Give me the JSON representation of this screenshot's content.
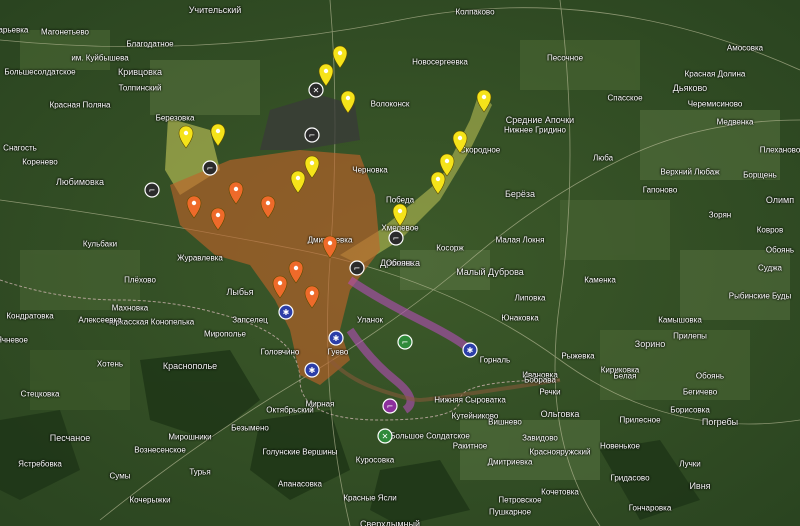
{
  "map": {
    "labels": [
      {
        "text": "Учительский"
      },
      {
        "text": "Колпаково"
      },
      {
        "text": "Марьевка"
      },
      {
        "text": "Амосовка"
      },
      {
        "text": "Магонетьево"
      },
      {
        "text": "Благодатное"
      },
      {
        "text": "им. Куйбышева"
      },
      {
        "text": "Кривцовка"
      },
      {
        "text": "Большесолдатское"
      },
      {
        "text": "Новосергеевка"
      },
      {
        "text": "Песочное"
      },
      {
        "text": "Волоконск"
      },
      {
        "text": "Спасское"
      },
      {
        "text": "Красная Долина"
      },
      {
        "text": "Дьяково"
      },
      {
        "text": "Черемисиново"
      },
      {
        "text": "Толпинский"
      },
      {
        "text": "Красная Поляна"
      },
      {
        "text": "Березовка"
      },
      {
        "text": "Нижнее Гридино"
      },
      {
        "text": "Медвенка"
      },
      {
        "text": "Средние Апочки"
      },
      {
        "text": "Снагость"
      },
      {
        "text": "Скородное"
      },
      {
        "text": "Люба"
      },
      {
        "text": "Верхний Любаж"
      },
      {
        "text": "Плеханово"
      },
      {
        "text": "Гапоново"
      },
      {
        "text": "Берёза"
      },
      {
        "text": "Победа"
      },
      {
        "text": "Малая Локня"
      },
      {
        "text": "Косорж"
      },
      {
        "text": "Борщень"
      },
      {
        "text": "Коренево"
      },
      {
        "text": "Липовка"
      },
      {
        "text": "Любимовка"
      },
      {
        "text": "Кульбаки"
      },
      {
        "text": "Обоянь"
      },
      {
        "text": "Суджа"
      },
      {
        "text": "Журавлевка"
      },
      {
        "text": "Плёхово"
      },
      {
        "text": "Махновка"
      },
      {
        "text": "Малый Дуброва"
      },
      {
        "text": "Дмитриевка"
      },
      {
        "text": "Юнаковка"
      },
      {
        "text": "Черкасская Конопелька"
      },
      {
        "text": "Алексеевка"
      },
      {
        "text": "Кондратовка"
      },
      {
        "text": "Мирополье"
      },
      {
        "text": "Лыбья"
      },
      {
        "text": "Ячневое"
      },
      {
        "text": "Уланок"
      },
      {
        "text": "Гуево"
      },
      {
        "text": "Головчино"
      },
      {
        "text": "Горналь"
      },
      {
        "text": "Хотень"
      },
      {
        "text": "Краснополье"
      },
      {
        "text": "Рыжевка"
      },
      {
        "text": "Ивановка"
      },
      {
        "text": "Кириковка"
      },
      {
        "text": "Бобрава"
      },
      {
        "text": "Белая"
      },
      {
        "text": "Обоянь"
      },
      {
        "text": "Зорино"
      },
      {
        "text": "Прилепы"
      },
      {
        "text": "Бегичево"
      },
      {
        "text": "Стецковка"
      },
      {
        "text": "Сумы"
      },
      {
        "text": "Речки"
      },
      {
        "text": "Нижняя Сыроватка"
      },
      {
        "text": "Ольговка"
      },
      {
        "text": "Кутейниково"
      },
      {
        "text": "Мирная"
      },
      {
        "text": "Вишнево"
      },
      {
        "text": "Прилесное"
      },
      {
        "text": "Завидово"
      },
      {
        "text": "Борисовка"
      },
      {
        "text": "Погребы"
      },
      {
        "text": "Ракитное"
      },
      {
        "text": "Краснояружский"
      },
      {
        "text": "Новенькое"
      },
      {
        "text": "Безымено"
      },
      {
        "text": "Октябрьский"
      },
      {
        "text": "Мирошники"
      },
      {
        "text": "Песчаное"
      },
      {
        "text": "Большое Солдатское"
      },
      {
        "text": "Голунские Вершины"
      },
      {
        "text": "Куросовка"
      },
      {
        "text": "Дмитриевка"
      },
      {
        "text": "Гридасово"
      },
      {
        "text": "Лучки"
      },
      {
        "text": "Ивня"
      },
      {
        "text": "Кочетовка"
      },
      {
        "text": "Красные Ясли"
      },
      {
        "text": "Вознесенское"
      },
      {
        "text": "Турья"
      },
      {
        "text": "Ястребовка"
      },
      {
        "text": "Апанасовка"
      },
      {
        "text": "Сверхдымный"
      },
      {
        "text": "Гончаровка"
      },
      {
        "text": "Пушкарное"
      },
      {
        "text": "Запселец"
      },
      {
        "text": "Черновка"
      },
      {
        "text": "Хмелевое"
      },
      {
        "text": "Зорян"
      },
      {
        "text": "Олимп"
      },
      {
        "text": "Каменка"
      },
      {
        "text": "Ковров"
      },
      {
        "text": "Камышовка"
      },
      {
        "text": "Петровское"
      },
      {
        "text": "Кочерыжки"
      },
      {
        "text": "Рыбинские Буды"
      },
      {
        "text": "Дроновка"
      },
      {
        "text": "Обоянь"
      }
    ],
    "colors": {
      "fire_zone": "#c0622a",
      "yellow_zone": "#f4f06a",
      "purple_route": "#b44cb8",
      "dark_zone": "#3a3a3a",
      "marker_yellow": "#f5e31a",
      "marker_orange": "#ee6a2a",
      "marker_blue": "#2c3ea8",
      "marker_dark": "#2b2b2b",
      "marker_green": "#2f8a3a",
      "marker_purple": "#8c2f9c"
    },
    "markers": [
      {
        "type": "yellow-pin"
      },
      {
        "type": "yellow-pin"
      },
      {
        "type": "yellow-pin"
      },
      {
        "type": "yellow-pin"
      },
      {
        "type": "yellow-pin"
      },
      {
        "type": "yellow-pin"
      },
      {
        "type": "yellow-pin"
      },
      {
        "type": "yellow-pin"
      },
      {
        "type": "yellow-pin"
      },
      {
        "type": "yellow-pin"
      },
      {
        "type": "yellow-pin"
      },
      {
        "type": "yellow-pin"
      },
      {
        "type": "orange-pin"
      },
      {
        "type": "orange-pin"
      },
      {
        "type": "orange-pin"
      },
      {
        "type": "orange-pin"
      },
      {
        "type": "orange-pin"
      },
      {
        "type": "orange-pin"
      },
      {
        "type": "orange-pin"
      },
      {
        "type": "orange-pin"
      },
      {
        "type": "blue-badge"
      },
      {
        "type": "blue-badge"
      },
      {
        "type": "blue-badge"
      },
      {
        "type": "blue-badge"
      },
      {
        "type": "dark-weapon"
      },
      {
        "type": "dark-weapon"
      },
      {
        "type": "dark-weapon"
      },
      {
        "type": "dark-weapon"
      },
      {
        "type": "dark-weapon"
      },
      {
        "type": "dark-x"
      },
      {
        "type": "green-x"
      },
      {
        "type": "purple-weapon"
      },
      {
        "type": "green-weapon"
      }
    ]
  }
}
